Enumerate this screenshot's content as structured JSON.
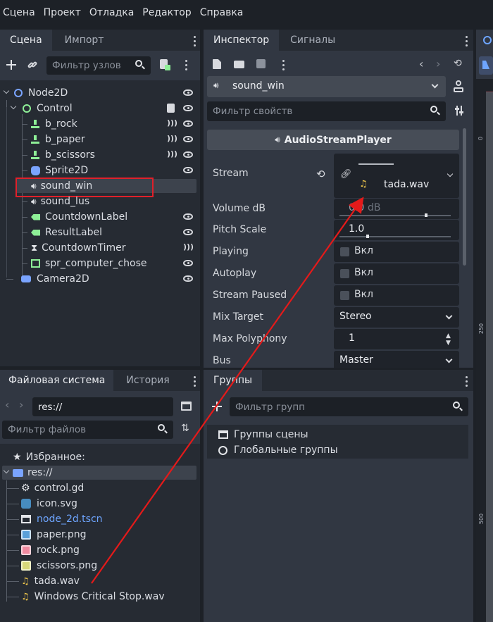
{
  "menu": [
    "Сцена",
    "Проект",
    "Отладка",
    "Редактор",
    "Справка"
  ],
  "scene_panel": {
    "tabs": [
      "Сцена",
      "Импорт"
    ],
    "filter_placeholder": "Фильтр узлов",
    "nodes": [
      {
        "label": "Node2D"
      },
      {
        "label": "Control"
      },
      {
        "label": "b_rock"
      },
      {
        "label": "b_paper"
      },
      {
        "label": "b_scissors"
      },
      {
        "label": "Sprite2D"
      },
      {
        "label": "sound_win"
      },
      {
        "label": "sound_lus"
      },
      {
        "label": "CountdownLabel"
      },
      {
        "label": "ResultLabel"
      },
      {
        "label": "CountdownTimer"
      },
      {
        "label": "spr_computer_chose"
      },
      {
        "label": "Camera2D"
      }
    ]
  },
  "inspector": {
    "tabs": [
      "Инспектор",
      "Сигналы"
    ],
    "object_name": "sound_win",
    "filter_placeholder": "Фильтр свойств",
    "class_title": "AudioStreamPlayer",
    "stream": {
      "label": "Stream",
      "file": "tada.wav"
    },
    "properties": [
      {
        "label": "Volume dB",
        "value": "0.0",
        "unit": "dB"
      },
      {
        "label": "Pitch Scale",
        "value": "1.0"
      },
      {
        "label": "Playing",
        "value": "Вкл"
      },
      {
        "label": "Autoplay",
        "value": "Вкл"
      },
      {
        "label": "Stream Paused",
        "value": "Вкл"
      },
      {
        "label": "Mix Target",
        "value": "Stereo"
      },
      {
        "label": "Max Polyphony",
        "value": "1"
      },
      {
        "label": "Bus",
        "value": "Master"
      }
    ]
  },
  "filesystem": {
    "tabs": [
      "Файловая система",
      "История"
    ],
    "path": "res://",
    "filter_placeholder": "Фильтр файлов",
    "favorites": "Избранное:",
    "root": "res://",
    "files": [
      "control.gd",
      "icon.svg",
      "node_2d.tscn",
      "paper.png",
      "rock.png",
      "scissors.png",
      "tada.wav",
      "Windows Critical Stop.wav"
    ]
  },
  "groups": {
    "tab": "Группы",
    "filter_placeholder": "Фильтр групп",
    "items": [
      "Группы сцены",
      "Глобальные группы"
    ]
  },
  "viewport": {
    "ruler_marks": [
      "0",
      "250",
      "500"
    ]
  },
  "colors": {
    "accent": "#6ea5ff",
    "highlight_box": "#e0202a",
    "annotation_arrow": "#e41a1a",
    "node2d_icon": "#7aa4ff",
    "control_icon": "#8eef97",
    "link_file": "#6ea5ff"
  }
}
